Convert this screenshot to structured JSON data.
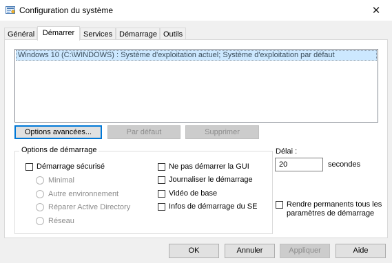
{
  "window": {
    "title": "Configuration du système"
  },
  "tabs": [
    {
      "label": "Général"
    },
    {
      "label": "Démarrer"
    },
    {
      "label": "Services"
    },
    {
      "label": "Démarrage"
    },
    {
      "label": "Outils"
    }
  ],
  "boot_list": {
    "items": [
      {
        "label": "Windows 10 (C:\\WINDOWS) : Système d'exploitation actuel; Système d'exploitation par défaut",
        "selected": true
      }
    ]
  },
  "list_buttons": {
    "advanced": "Options avancées...",
    "default": "Par défaut",
    "delete": "Supprimer"
  },
  "boot_options": {
    "title": "Options de démarrage",
    "safe_boot": {
      "label": "Démarrage sécurisé",
      "checked": false
    },
    "safe_modes": [
      {
        "label": "Minimal"
      },
      {
        "label": "Autre environnement"
      },
      {
        "label": "Réparer Active Directory"
      },
      {
        "label": "Réseau"
      }
    ],
    "right_checks": [
      {
        "label": "Ne pas démarrer la GUI",
        "checked": false
      },
      {
        "label": "Journaliser le démarrage",
        "checked": false
      },
      {
        "label": "Vidéo de base",
        "checked": false
      },
      {
        "label": "Infos de démarrage du SE",
        "checked": false
      }
    ]
  },
  "timeout": {
    "label": "Délai :",
    "value": "20",
    "unit": "secondes"
  },
  "persist": {
    "label": "Rendre permanents tous les paramètres de démarrage",
    "checked": false
  },
  "footer": {
    "ok": "OK",
    "cancel": "Annuler",
    "apply": "Appliquer",
    "help": "Aide"
  },
  "colors": {
    "selection": "#cce8ff",
    "focus_border": "#0078d7"
  }
}
